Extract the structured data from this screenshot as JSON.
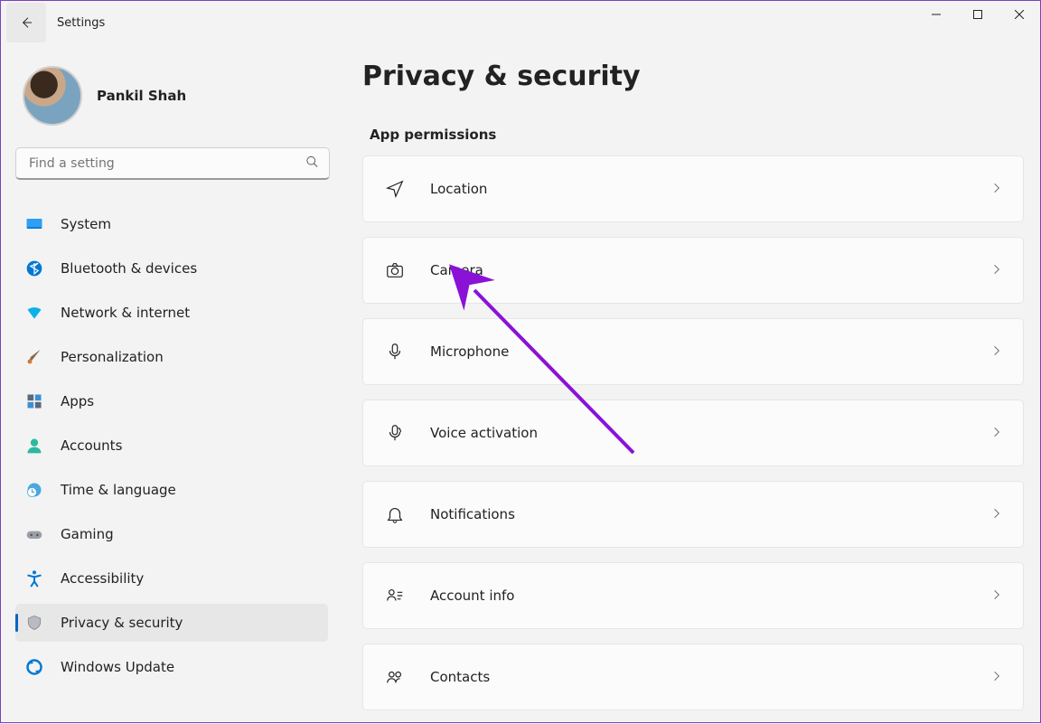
{
  "app": {
    "title": "Settings"
  },
  "profile": {
    "name": "Pankil Shah"
  },
  "search": {
    "placeholder": "Find a setting"
  },
  "nav": {
    "items": [
      {
        "id": "system",
        "label": "System"
      },
      {
        "id": "bluetooth",
        "label": "Bluetooth & devices"
      },
      {
        "id": "network",
        "label": "Network & internet"
      },
      {
        "id": "personalization",
        "label": "Personalization"
      },
      {
        "id": "apps",
        "label": "Apps"
      },
      {
        "id": "accounts",
        "label": "Accounts"
      },
      {
        "id": "time",
        "label": "Time & language"
      },
      {
        "id": "gaming",
        "label": "Gaming"
      },
      {
        "id": "accessibility",
        "label": "Accessibility"
      },
      {
        "id": "privacy",
        "label": "Privacy & security"
      },
      {
        "id": "update",
        "label": "Windows Update"
      }
    ],
    "active": "privacy"
  },
  "main": {
    "title": "Privacy & security",
    "section": "App permissions",
    "cards": [
      {
        "id": "location",
        "label": "Location"
      },
      {
        "id": "camera",
        "label": "Camera"
      },
      {
        "id": "microphone",
        "label": "Microphone"
      },
      {
        "id": "voice",
        "label": "Voice activation"
      },
      {
        "id": "notifications",
        "label": "Notifications"
      },
      {
        "id": "account-info",
        "label": "Account info"
      },
      {
        "id": "contacts",
        "label": "Contacts"
      }
    ]
  }
}
